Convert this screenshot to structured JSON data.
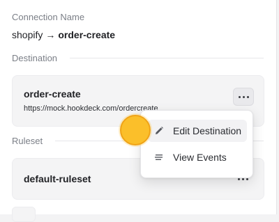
{
  "connection": {
    "label": "Connection Name",
    "source": "shopify",
    "arrow": "→",
    "destination": "order-create"
  },
  "destination_section": {
    "label": "Destination",
    "card": {
      "title": "order-create",
      "url": "https://mock.hookdeck.com/ordercreate"
    }
  },
  "ruleset_section": {
    "label": "Ruleset",
    "card": {
      "title": "default-ruleset"
    }
  },
  "dropdown": {
    "items": [
      {
        "label": "Edit Destination",
        "icon": "pencil-icon"
      },
      {
        "label": "View Events",
        "icon": "list-icon"
      }
    ]
  },
  "colors": {
    "cursor": "#fbbf2a",
    "text": "#1f2024",
    "muted": "#7b7f87"
  }
}
